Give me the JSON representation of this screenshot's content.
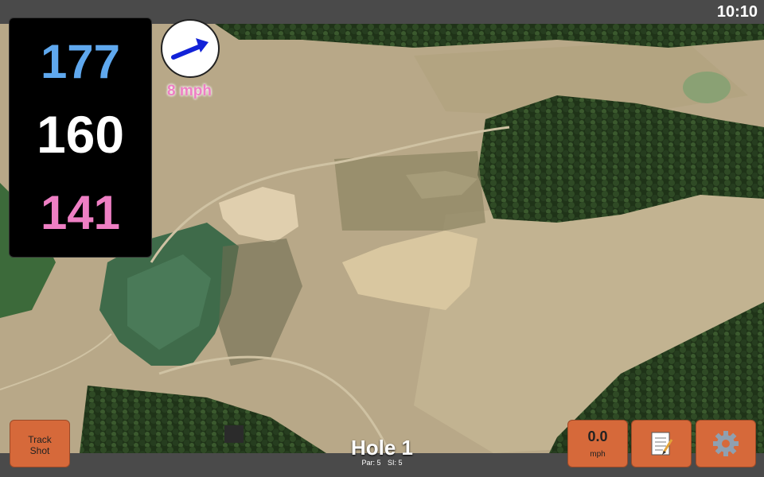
{
  "status": {
    "time": "10:10"
  },
  "distances": {
    "back": "177",
    "middle": "160",
    "front": "141"
  },
  "wind": {
    "speed_label": "8 mph",
    "icon": "wind-direction-arrow-icon"
  },
  "buttons": {
    "track_shot": [
      "Track",
      "Shot"
    ],
    "wind_value": "0.0",
    "wind_unit": "mph",
    "notes_icon": "notepad-icon",
    "settings_icon": "gear-icon"
  },
  "hole": {
    "title": "Hole 1",
    "par": "Par: 5",
    "si": "SI: 5"
  },
  "colors": {
    "button": "#d6693a",
    "back": "#5fa8ee",
    "front": "#ee7fc4"
  }
}
